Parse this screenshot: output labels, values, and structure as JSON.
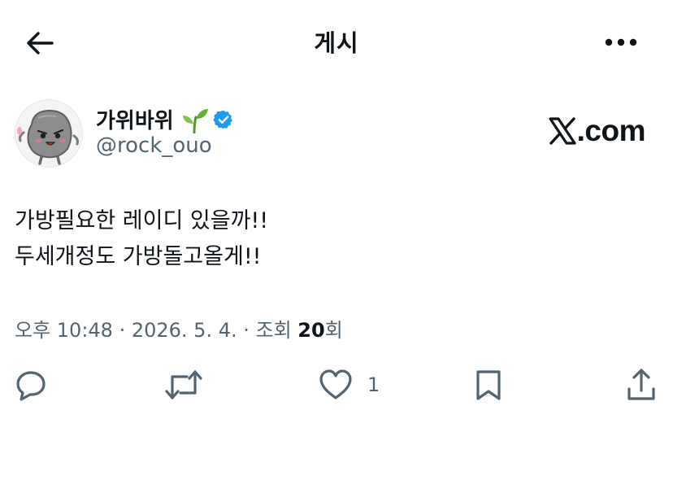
{
  "header": {
    "title": "게시",
    "back_icon": "arrow-left-icon",
    "more_icon": "more-horizontal-icon"
  },
  "author": {
    "display_name": "가위바위",
    "name_emoji": "seedling-icon",
    "verified": true,
    "handle": "@rock_ouo",
    "avatar": "rock-character-avatar"
  },
  "source_badge": {
    "text": ".com",
    "icon": "x-logo-icon"
  },
  "post": {
    "lines": [
      "가방필요한 레이디 있을까!!",
      "두세개정도 가방돌고올게!!"
    ]
  },
  "meta": {
    "time": "오후 10:48",
    "separator": " · ",
    "date": "2026. 5. 4.",
    "views_label_prefix": "조회 ",
    "views_count": "20",
    "views_label_suffix": "회"
  },
  "actions": {
    "reply_icon": "reply-icon",
    "repost_icon": "repost-icon",
    "like_icon": "heart-icon",
    "like_count": "1",
    "bookmark_icon": "bookmark-icon",
    "share_icon": "share-icon"
  },
  "colors": {
    "text_primary": "#0f1419",
    "text_secondary": "#536471",
    "verified_blue": "#1d9bf0",
    "background": "#ffffff"
  }
}
